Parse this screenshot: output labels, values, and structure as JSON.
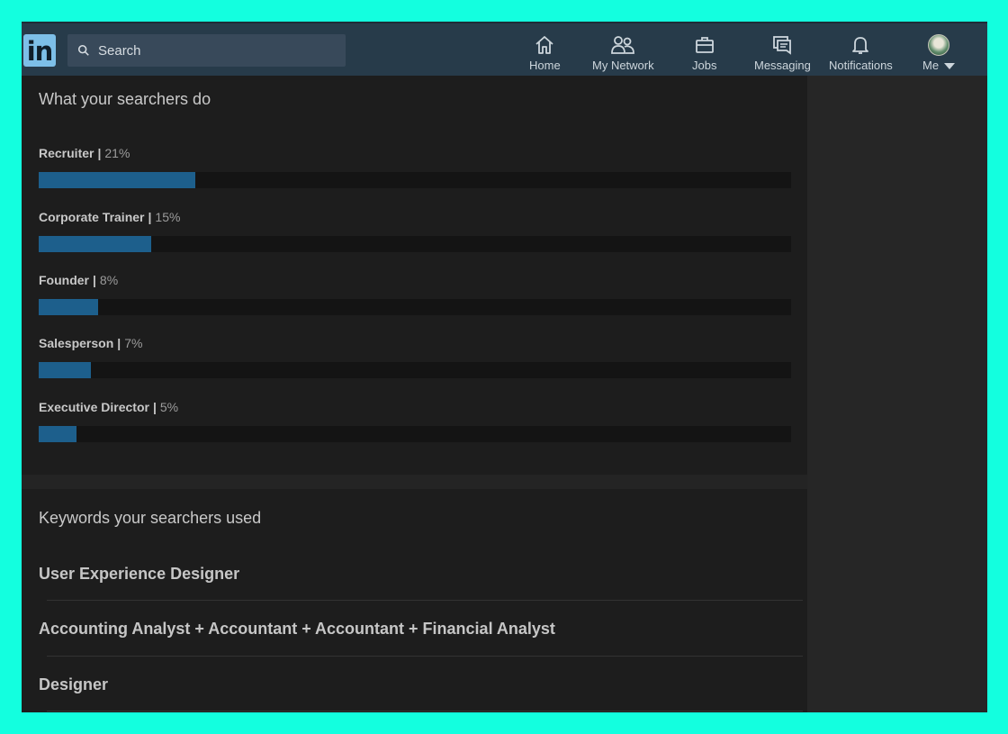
{
  "nav": {
    "logo_text": "in",
    "search_placeholder": "Search",
    "items": [
      {
        "label": "Home",
        "icon": "home-icon"
      },
      {
        "label": "My Network",
        "icon": "network-icon"
      },
      {
        "label": "Jobs",
        "icon": "briefcase-icon"
      },
      {
        "label": "Messaging",
        "icon": "messaging-icon"
      },
      {
        "label": "Notifications",
        "icon": "bell-icon"
      },
      {
        "label": "Me",
        "icon": "avatar"
      }
    ]
  },
  "searchers": {
    "title": "What your searchers do",
    "separator": "|",
    "items": [
      {
        "name": "Recruiter",
        "percent_label": "21%",
        "percent": 21
      },
      {
        "name": "Corporate Trainer",
        "percent_label": "15%",
        "percent": 15
      },
      {
        "name": "Founder",
        "percent_label": "8%",
        "percent": 8
      },
      {
        "name": "Salesperson",
        "percent_label": "7%",
        "percent": 7
      },
      {
        "name": "Executive Director",
        "percent_label": "5%",
        "percent": 5
      }
    ]
  },
  "keywords": {
    "title": "Keywords your searchers used",
    "items": [
      "User Experience Designer",
      "Accounting Analyst + Accountant + Accountant + Financial Analyst",
      "Designer"
    ]
  },
  "colors": {
    "accent_bar": "#1d5f8c",
    "navbar": "#273b4a",
    "frame": "#13ffdf"
  }
}
